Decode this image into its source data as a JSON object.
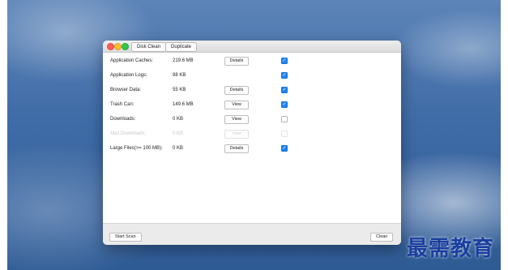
{
  "window": {
    "tabs": [
      "Disk Clean",
      "Duplicate"
    ]
  },
  "rows": [
    {
      "label": "Application Caches:",
      "size": "219.6 MB",
      "action": "Details",
      "checked": true,
      "enabled": true
    },
    {
      "label": "Application Logs:",
      "size": "98 KB",
      "action": "",
      "checked": true,
      "enabled": true
    },
    {
      "label": "Browser Data:",
      "size": "55 KB",
      "action": "Details",
      "checked": true,
      "enabled": true
    },
    {
      "label": "Trash Can:",
      "size": "149.6 MB",
      "action": "View",
      "checked": true,
      "enabled": true
    },
    {
      "label": "Downloads:",
      "size": "0 KB",
      "action": "View",
      "checked": false,
      "enabled": true
    },
    {
      "label": "Mail Downloads:",
      "size": "0 KB",
      "action": "View",
      "checked": false,
      "enabled": false
    },
    {
      "label": "Large Files(>= 100 MB):",
      "size": "0 KB",
      "action": "Details",
      "checked": true,
      "enabled": true
    }
  ],
  "footer": {
    "start_scan": "Start Scan",
    "clean": "Clean"
  },
  "watermark": "最需教育",
  "colors": {
    "checkbox_on": "#1e84f4",
    "watermark": "#1a3e9e"
  }
}
